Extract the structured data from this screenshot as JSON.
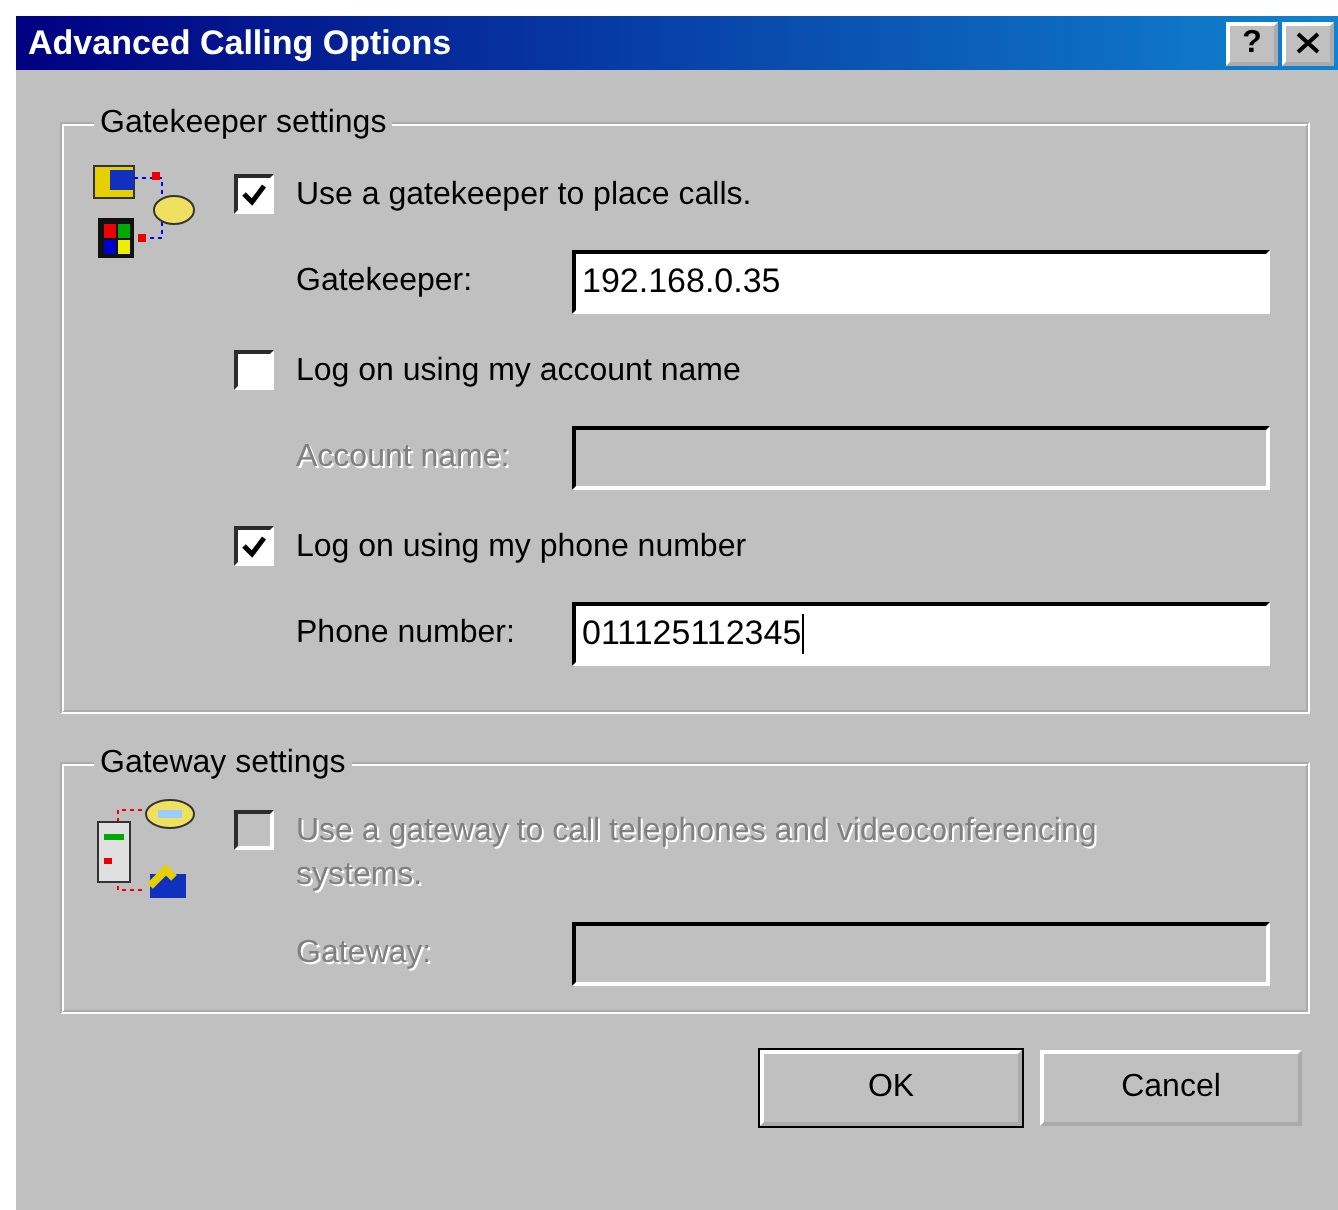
{
  "window": {
    "title": "Advanced Calling Options",
    "help_label": "?"
  },
  "groups": [
    {
      "title": "Gatekeeper settings",
      "kind": "gatekeeper",
      "rows": [
        {
          "kind": "checkbox",
          "label": "Use a gatekeeper to place calls.",
          "checked": true,
          "disabled": false
        },
        {
          "kind": "field",
          "label": "Gatekeeper:",
          "value": "192.168.0.35",
          "disabled": false,
          "focused": false
        },
        {
          "kind": "checkbox",
          "label": "Log on using my account name",
          "checked": false,
          "disabled": false
        },
        {
          "kind": "field",
          "label": "Account name:",
          "value": "",
          "disabled": true,
          "focused": false
        },
        {
          "kind": "checkbox",
          "label": "Log on using my phone number",
          "checked": true,
          "disabled": false
        },
        {
          "kind": "field",
          "label": "Phone number:",
          "value": "011125112345",
          "disabled": false,
          "focused": true
        }
      ]
    },
    {
      "title": "Gateway settings",
      "kind": "gateway",
      "rows": [
        {
          "kind": "checkbox",
          "label": "Use a gateway to call telephones and videoconferencing systems.",
          "checked": false,
          "disabled": true
        },
        {
          "kind": "field",
          "label": "Gateway:",
          "value": "",
          "disabled": true,
          "focused": false
        }
      ]
    }
  ],
  "buttons": [
    {
      "label": "OK",
      "default": true
    },
    {
      "label": "Cancel",
      "default": false
    }
  ]
}
